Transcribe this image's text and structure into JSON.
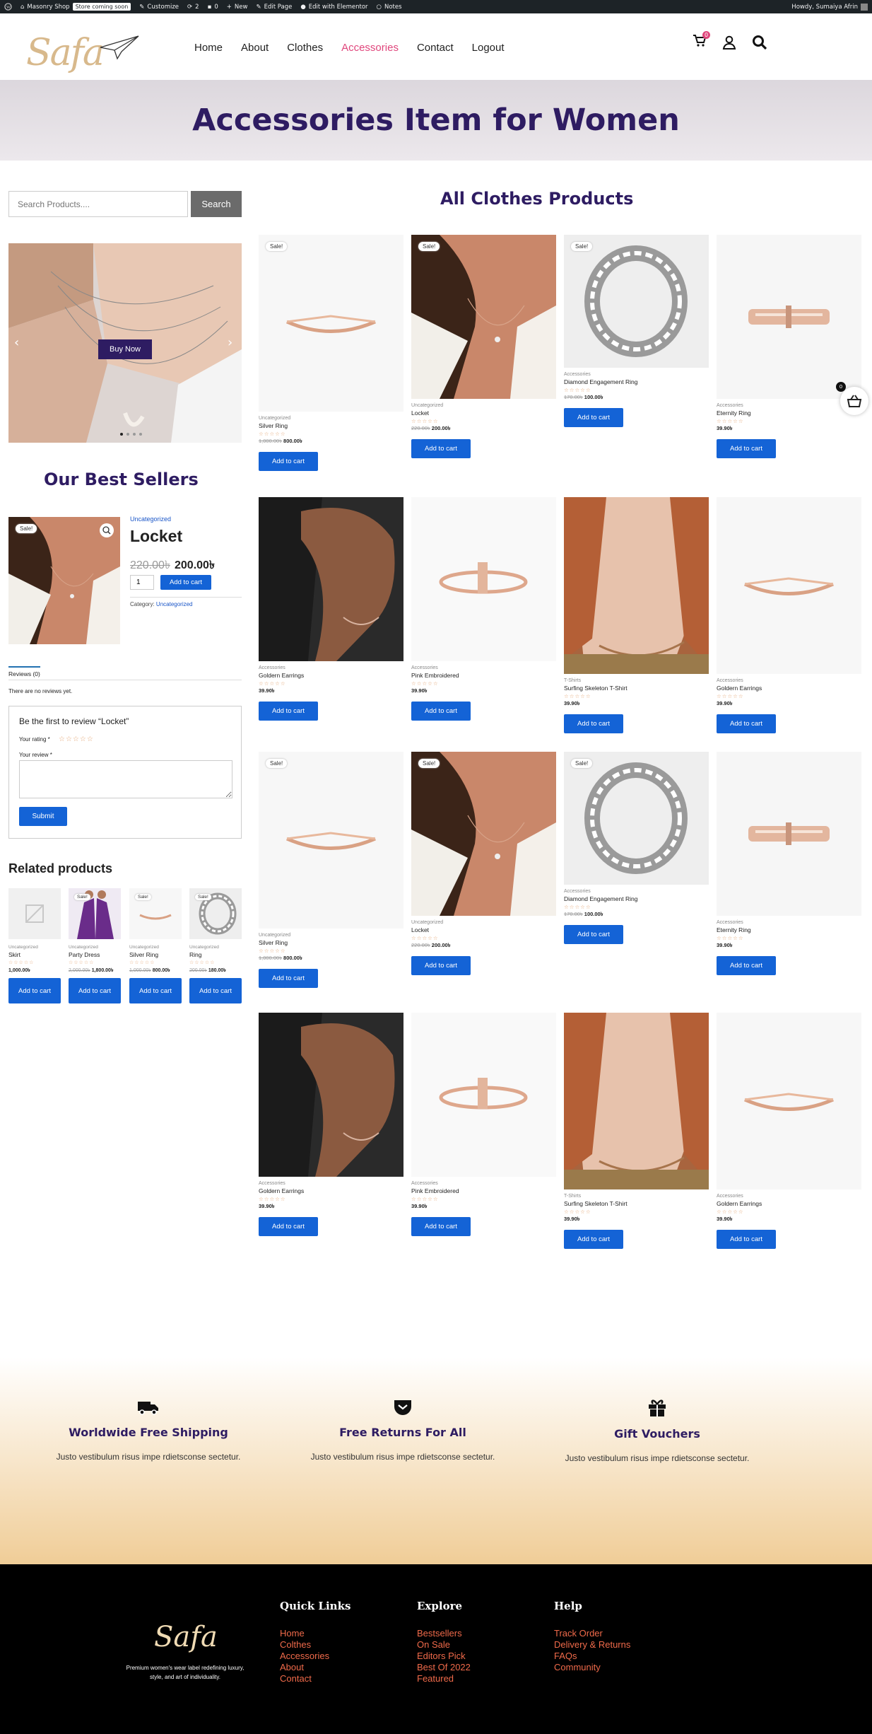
{
  "adminbar": {
    "site": "Masonry Shop",
    "badge": "Store coming soon",
    "customize": "Customize",
    "updates": "2",
    "comments": "0",
    "new": "New",
    "edit_page": "Edit Page",
    "elementor": "Edit with Elementor",
    "notes": "Notes",
    "howdy": "Howdy, Sumaiya Afrin"
  },
  "header": {
    "logo": "Safa",
    "nav": [
      "Home",
      "About",
      "Clothes",
      "Accessories",
      "Contact",
      "Logout"
    ],
    "active_nav": "Accessories",
    "cart_count": "0"
  },
  "banner": {
    "title": "Accessories Item for Women"
  },
  "sidebar": {
    "search_placeholder": "Search Products....",
    "search_button": "Search",
    "slider_button": "Buy Now",
    "best_sellers_title": "Our Best Sellers",
    "best": {
      "sale": "Sale!",
      "category": "Uncategorized",
      "name": "Locket",
      "old_price": "220.00৳",
      "new_price": "200.00৳",
      "qty": "1",
      "add": "Add to cart",
      "category_label": "Category:",
      "category_link": "Uncategorized"
    },
    "reviews_tab": "Reviews (0)",
    "no_reviews": "There are no reviews yet.",
    "review_form": {
      "title": "Be the first to review “Locket”",
      "rating_label": "Your rating *",
      "stars": "☆☆☆☆☆",
      "review_label": "Your review *",
      "submit": "Submit"
    },
    "related_title": "Related products",
    "related": [
      {
        "cat": "Uncategorized",
        "name": "Skirt",
        "stars": "☆☆☆☆☆",
        "old": "",
        "price": "1,000.00৳",
        "sale": "",
        "btn": "Add to cart"
      },
      {
        "cat": "Uncategorized",
        "name": "Party Dress",
        "stars": "☆☆☆☆☆",
        "old": "2,000.00৳",
        "price": "1,800.00৳",
        "sale": "Sale!",
        "btn": "Add to cart"
      },
      {
        "cat": "Uncategorized",
        "name": "Silver Ring",
        "stars": "☆☆☆☆☆",
        "old": "1,000.00৳",
        "price": "800.00৳",
        "sale": "Sale!",
        "btn": "Add to cart"
      },
      {
        "cat": "Uncategorized",
        "name": "Ring",
        "stars": "☆☆☆☆☆",
        "old": "200.00৳",
        "price": "180.00৳",
        "sale": "Sale!",
        "btn": "Add to cart"
      }
    ]
  },
  "products": {
    "title": "All Clothes Products",
    "items": [
      {
        "cat": "Uncategorized",
        "name": "Silver Ring",
        "stars": "☆☆☆☆☆",
        "old": "1,000.00৳",
        "price": "800.00৳",
        "sale": "Sale!",
        "btn": "Add to cart",
        "img": "ring"
      },
      {
        "cat": "Uncategorized",
        "name": "Locket",
        "stars": "☆☆☆☆☆",
        "old": "220.00৳",
        "price": "200.00৳",
        "sale": "Sale!",
        "btn": "Add to cart",
        "img": "neck"
      },
      {
        "cat": "Accessories",
        "name": "Diamond Engagement Ring",
        "stars": "☆☆☆☆☆",
        "old": "170.00৳",
        "price": "100.00৳",
        "sale": "Sale!",
        "btn": "Add to cart",
        "img": "diam"
      },
      {
        "cat": "Accessories",
        "name": "Eternity Ring",
        "stars": "☆☆☆☆☆",
        "old": "",
        "price": "39.90৳",
        "sale": "",
        "btn": "Add to cart",
        "img": "eter"
      },
      {
        "cat": "Accessories",
        "name": "Goldern Earrings",
        "stars": "☆☆☆☆☆",
        "old": "",
        "price": "39.90৳",
        "sale": "",
        "btn": "Add to cart",
        "img": "hand"
      },
      {
        "cat": "Accessories",
        "name": "Pink Embroidered",
        "stars": "☆☆☆☆☆",
        "old": "",
        "price": "39.90৳",
        "sale": "",
        "btn": "Add to cart",
        "img": "tring"
      },
      {
        "cat": "T-Shirts",
        "name": "Surfing Skeleton T-Shirt",
        "stars": "☆☆☆☆☆",
        "old": "",
        "price": "39.90৳",
        "sale": "",
        "btn": "Add to cart",
        "img": "face"
      },
      {
        "cat": "Accessories",
        "name": "Goldern Earrings",
        "stars": "☆☆☆☆☆",
        "old": "",
        "price": "39.90৳",
        "sale": "",
        "btn": "Add to cart",
        "img": "ring"
      },
      {
        "cat": "Uncategorized",
        "name": "Silver Ring",
        "stars": "☆☆☆☆☆",
        "old": "1,000.00৳",
        "price": "800.00৳",
        "sale": "Sale!",
        "btn": "Add to cart",
        "img": "ring"
      },
      {
        "cat": "Uncategorized",
        "name": "Locket",
        "stars": "☆☆☆☆☆",
        "old": "220.00৳",
        "price": "200.00৳",
        "sale": "Sale!",
        "btn": "Add to cart",
        "img": "neck"
      },
      {
        "cat": "Accessories",
        "name": "Diamond Engagement Ring",
        "stars": "☆☆☆☆☆",
        "old": "170.00৳",
        "price": "100.00৳",
        "sale": "Sale!",
        "btn": "Add to cart",
        "img": "diam"
      },
      {
        "cat": "Accessories",
        "name": "Eternity Ring",
        "stars": "☆☆☆☆☆",
        "old": "",
        "price": "39.90৳",
        "sale": "",
        "btn": "Add to cart",
        "img": "eter"
      },
      {
        "cat": "Accessories",
        "name": "Goldern Earrings",
        "stars": "☆☆☆☆☆",
        "old": "",
        "price": "39.90৳",
        "sale": "",
        "btn": "Add to cart",
        "img": "hand"
      },
      {
        "cat": "Accessories",
        "name": "Pink Embroidered",
        "stars": "☆☆☆☆☆",
        "old": "",
        "price": "39.90৳",
        "sale": "",
        "btn": "Add to cart",
        "img": "tring"
      },
      {
        "cat": "T-Shirts",
        "name": "Surfing Skeleton T-Shirt",
        "stars": "☆☆☆☆☆",
        "old": "",
        "price": "39.90৳",
        "sale": "",
        "btn": "Add to cart",
        "img": "face"
      },
      {
        "cat": "Accessories",
        "name": "Goldern Earrings",
        "stars": "☆☆☆☆☆",
        "old": "",
        "price": "39.90৳",
        "sale": "",
        "btn": "Add to cart",
        "img": "ring"
      }
    ]
  },
  "floating_cart": {
    "count": "0"
  },
  "features": [
    {
      "icon": "truck-icon",
      "title": "Worldwide Free Shipping",
      "desc": "Justo vestibulum risus impe rdietsconse sectetur."
    },
    {
      "icon": "pocket-icon",
      "title": "Free Returns For All",
      "desc": "Justo vestibulum risus impe rdietsconse sectetur."
    },
    {
      "icon": "gift-icon",
      "title": "Gift Vouchers",
      "desc": "Justo vestibulum risus impe rdietsconse sectetur."
    }
  ],
  "footer": {
    "logo": "Safa",
    "tagline": "Premium women's wear label redefining luxury, style, and art of individuality.",
    "columns": [
      {
        "title": "Quick Links",
        "links": [
          "Home",
          "Colthes",
          "Accessories",
          "About",
          "Contact"
        ]
      },
      {
        "title": "Explore",
        "links": [
          "Bestsellers",
          "On Sale",
          "Editors Pick",
          "Best Of 2022",
          "Featured"
        ]
      },
      {
        "title": "Help",
        "links": [
          "Track Order",
          "Delivery & Returns",
          "FAQs",
          "Community"
        ]
      }
    ]
  },
  "colors": {
    "brand_purple": "#2e1c62",
    "accent_pink": "#e0467c",
    "button_blue": "#1463d6",
    "footer_link": "#f06a4a"
  }
}
